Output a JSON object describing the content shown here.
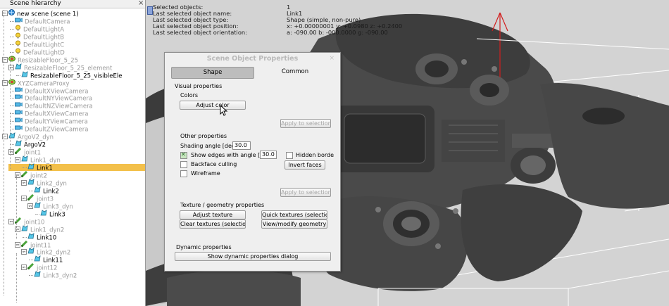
{
  "hierarchy": {
    "title": "Scene hierarchy",
    "rows": [
      {
        "label": "new scene (scene 1)",
        "icon": "globe-icon",
        "bold": true
      },
      {
        "label": "DefaultCamera",
        "icon": "camera-icon"
      },
      {
        "label": "DefaultLightA",
        "icon": "light-icon"
      },
      {
        "label": "DefaultLightB",
        "icon": "light-icon"
      },
      {
        "label": "DefaultLightC",
        "icon": "light-icon"
      },
      {
        "label": "DefaultLightD",
        "icon": "light-icon"
      },
      {
        "label": "ResizableFloor_5_25",
        "icon": "model-icon"
      },
      {
        "label": "ResizableFloor_5_25_element",
        "icon": "shape-icon"
      },
      {
        "label": "ResizableFloor_5_25_visibleEle",
        "icon": "shape-icon",
        "bold": true
      },
      {
        "label": "XYZCameraProxy",
        "icon": "model-icon"
      },
      {
        "label": "DefaultXViewCamera",
        "icon": "camera-icon"
      },
      {
        "label": "DefaultNYViewCamera",
        "icon": "camera-icon"
      },
      {
        "label": "DefaultNZViewCamera",
        "icon": "camera-icon"
      },
      {
        "label": "DefaultXViewCamera",
        "icon": "camera-icon"
      },
      {
        "label": "DefaultYViewCamera",
        "icon": "camera-icon"
      },
      {
        "label": "DefaultZViewCamera",
        "icon": "camera-icon"
      },
      {
        "label": "ArgoV2_dyn",
        "icon": "shape-icon"
      },
      {
        "label": "ArgoV2",
        "icon": "shape-icon",
        "bold": true
      },
      {
        "label": "joint1",
        "icon": "joint-icon"
      },
      {
        "label": "Link1_dyn",
        "icon": "shape-icon"
      },
      {
        "label": "Link1",
        "icon": "shape-icon",
        "bold": true,
        "selected": true
      },
      {
        "label": "joint2",
        "icon": "joint-icon"
      },
      {
        "label": "Link2_dyn",
        "icon": "shape-icon"
      },
      {
        "label": "Link2",
        "icon": "shape-icon",
        "bold": true
      },
      {
        "label": "joint3",
        "icon": "joint-icon"
      },
      {
        "label": "Link3_dyn",
        "icon": "shape-icon"
      },
      {
        "label": "Link3",
        "icon": "shape-icon",
        "bold": true
      },
      {
        "label": "joint10",
        "icon": "joint-icon"
      },
      {
        "label": "Link1_dyn2",
        "icon": "shape-icon"
      },
      {
        "label": "Link10",
        "icon": "shape-icon",
        "bold": true
      },
      {
        "label": "joint11",
        "icon": "joint-icon"
      },
      {
        "label": "Link2_dyn2",
        "icon": "shape-icon"
      },
      {
        "label": "Link11",
        "icon": "shape-icon",
        "bold": true
      },
      {
        "label": "joint12",
        "icon": "joint-icon"
      },
      {
        "label": "Link3_dyn2",
        "icon": "shape-icon"
      }
    ]
  },
  "info": [
    {
      "key": "Selected objects:",
      "value": "1"
    },
    {
      "key": "Last selected object name:",
      "value": "Link1"
    },
    {
      "key": "Last selected object type:",
      "value": "Shape (simple, non-pure)"
    },
    {
      "key": "Last selected object position:",
      "value": "x: +0.00000001   y: +0.0980   z: +0.2400"
    },
    {
      "key": "Last selected object orientation:",
      "value": "a: -090.00   b: -000.0000   g: -090.00"
    }
  ],
  "dialog": {
    "title": "Scene Object Properties",
    "close": "×",
    "tabs": {
      "shape": "Shape",
      "common": "Common"
    },
    "visual_properties": "Visual properties",
    "colors": "Colors",
    "adjust_color": "Adjust color",
    "apply_to_selection_1": "Apply to selection",
    "other_properties": "Other properties",
    "shading_label": "Shading angle [deg]",
    "shading_value": "30.0",
    "show_edges_label": "Show edges with angle [de",
    "show_edges_value": "30.0",
    "hidden_border": "Hidden borde",
    "backface_culling": "Backface culling",
    "invert_faces": "Invert faces",
    "wireframe": "Wireframe",
    "apply_to_selection_2": "Apply to selection",
    "texture_geometry": "Texture / geometry properties",
    "adjust_texture": "Adjust texture",
    "quick_textures": "Quick textures (selection)",
    "clear_textures": "Clear textures (selection)",
    "view_modify_geometry": "View/modify geometry",
    "dynamic_properties": "Dynamic properties",
    "show_dynamic_dialog": "Show dynamic properties dialog"
  },
  "colors": {
    "selection": "#f3c04a",
    "axis_red": "#d21e1e"
  }
}
